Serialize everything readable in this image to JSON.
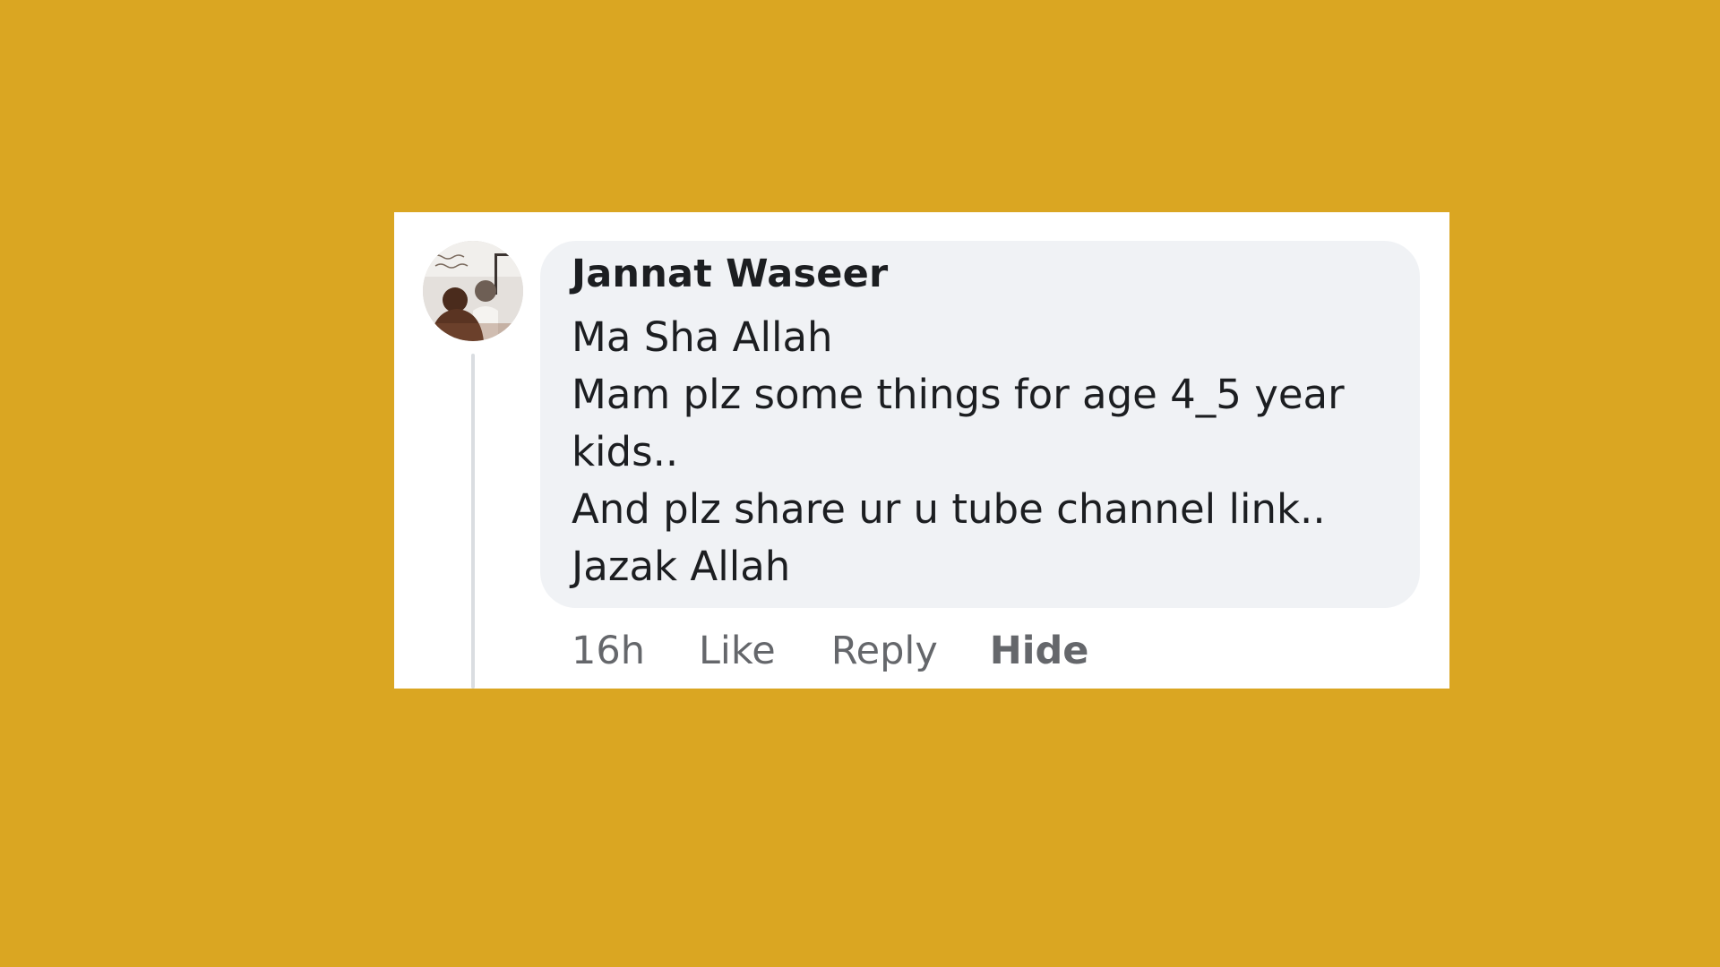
{
  "comment": {
    "author": "Jannat Waseer",
    "lines": [
      "Ma Sha Allah",
      "Mam plz some things for age 4_5 year",
      "kids..",
      "And plz share ur u tube channel link..",
      "Jazak Allah"
    ],
    "timestamp": "16h",
    "actions": {
      "like": "Like",
      "reply": "Reply",
      "hide": "Hide"
    }
  },
  "colors": {
    "background": "#DAA622",
    "card": "#FFFFFF",
    "bubble": "#F0F2F5",
    "text_primary": "#1C1E21",
    "text_secondary": "#65676B",
    "thread_line": "#DADDE1"
  }
}
